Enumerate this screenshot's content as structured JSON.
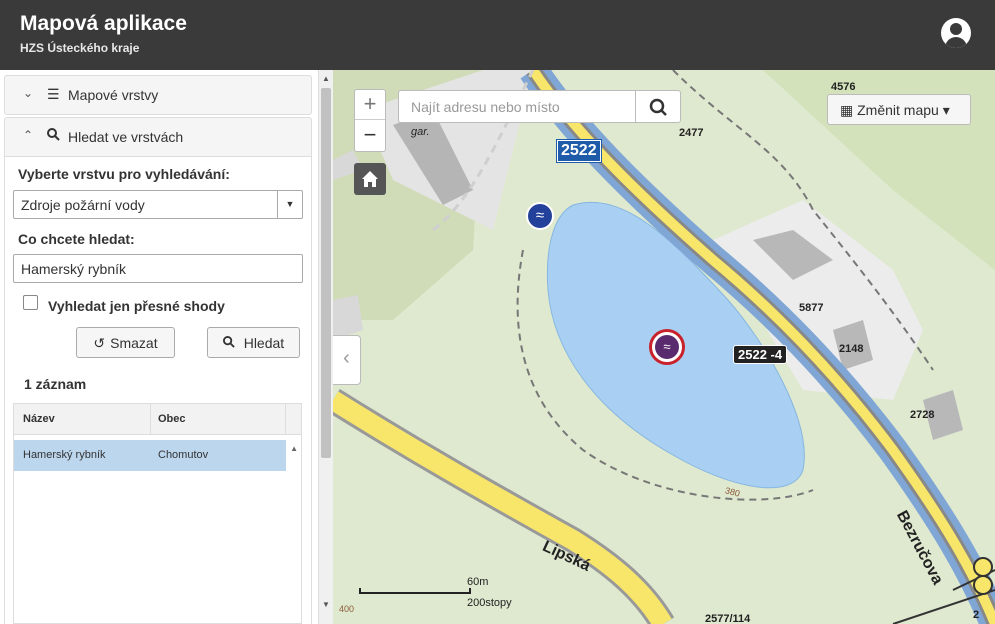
{
  "header": {
    "title": "Mapová aplikace",
    "subtitle": "HZS Ústeckého kraje",
    "user_icon": "user-circle-icon"
  },
  "sidebar": {
    "accordion": [
      {
        "label": "Mapové vrstvy",
        "icon": "list-icon",
        "state": "collapsed"
      },
      {
        "label": "Hledat ve vrstvách",
        "icon": "search-icon",
        "state": "expanded"
      }
    ],
    "search_panel": {
      "layer_label": "Vyberte vrstvu pro vyhledávání:",
      "layer_value": "Zdroje požární vody",
      "query_label": "Co chcete hledat:",
      "query_value": "Hamerský rybník",
      "exact_match_label": "Vyhledat jen přesné shody",
      "exact_match_checked": false,
      "clear_button": "Smazat",
      "search_button": "Hledat",
      "result_count": "1 záznam",
      "columns": [
        "Název",
        "Obec"
      ],
      "rows": [
        {
          "name": "Hamerský rybník",
          "municipality": "Chomutov"
        }
      ]
    }
  },
  "map": {
    "search_placeholder": "Najít adresu nebo místo",
    "change_map_label": "Změnit mapu",
    "zoom_in": "+",
    "zoom_out": "−",
    "labels": {
      "gar": "gar.",
      "n2477": "2477",
      "n4576": "4576",
      "road_2522": "2522",
      "road_2522_4": "2522 -4",
      "n5877": "5877",
      "n2148": "2148",
      "n2728": "2728",
      "street_bezrucova": "Bezručova",
      "street_lipska": "Lipská",
      "n380": "380",
      "n400": "400",
      "n2577_114": "2577/114",
      "n2_partial": "2"
    },
    "scale": {
      "meters": "60m",
      "steps": "200stopy"
    },
    "colors": {
      "water": "#a9d0f2",
      "road_yellow": "#f7e66a",
      "terrain": "#dfe9cf",
      "header": "#3a3a3a"
    }
  }
}
